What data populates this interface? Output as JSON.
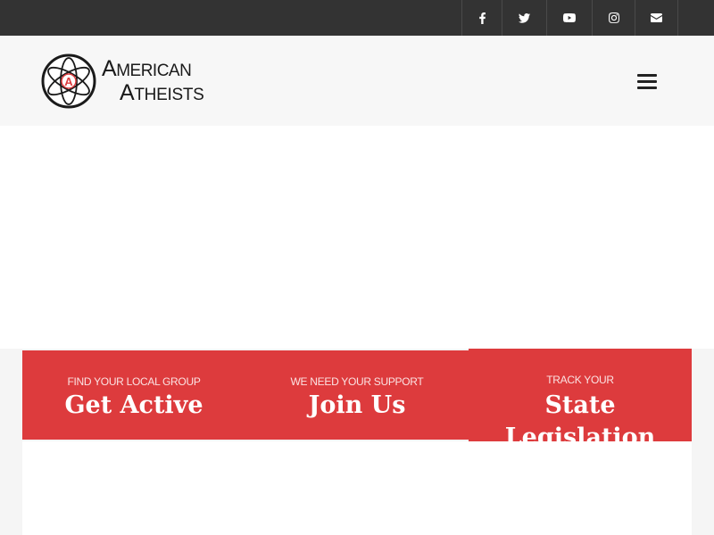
{
  "social": [
    {
      "name": "facebook-icon"
    },
    {
      "name": "twitter-icon"
    },
    {
      "name": "youtube-icon"
    },
    {
      "name": "instagram-icon"
    },
    {
      "name": "envelope-icon"
    }
  ],
  "brand": {
    "line1_first": "A",
    "line1_rest": "MERICAN",
    "line2_first": "A",
    "line2_rest": "THEISTS",
    "logo_letter": "A"
  },
  "nav": {
    "menu_icon": "hamburger-icon"
  },
  "cta": [
    {
      "small": "FIND YOUR LOCAL GROUP",
      "big": "Get Active"
    },
    {
      "small": "WE NEED YOUR SUPPORT",
      "big": "Join Us"
    },
    {
      "small": "TRACK YOUR",
      "big_line1": "State",
      "big_line2": "Legislation"
    }
  ],
  "colors": {
    "topbar": "#333333",
    "accent_red": "#dd3b3d",
    "header_bg": "#f7f7f7"
  }
}
